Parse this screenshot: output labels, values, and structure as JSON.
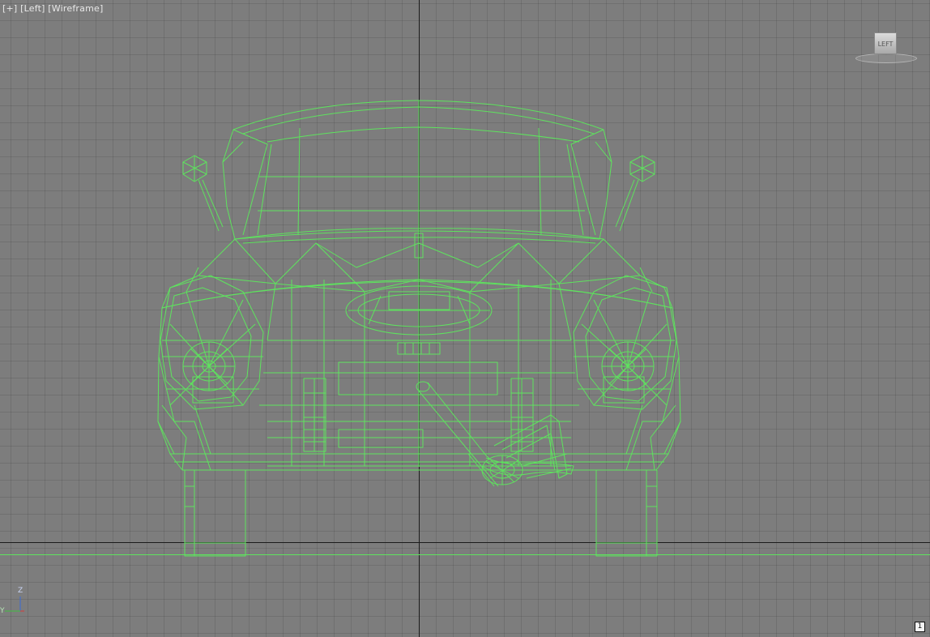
{
  "viewport": {
    "label_plus": "[+]",
    "label_view": "[Left]",
    "label_mode": "[Wireframe]",
    "viewcube_face": "LEFT",
    "viewport_number": "1",
    "axes": {
      "vertical": "Z",
      "horizontal": "Y"
    }
  },
  "colors": {
    "background": "#7d7d7d",
    "wireframe": "#5ee35e",
    "grid_major": "#1b1b1b"
  },
  "icons": {
    "viewcube": "viewcube-icon",
    "axis_tripod": "axis-tripod-icon"
  }
}
